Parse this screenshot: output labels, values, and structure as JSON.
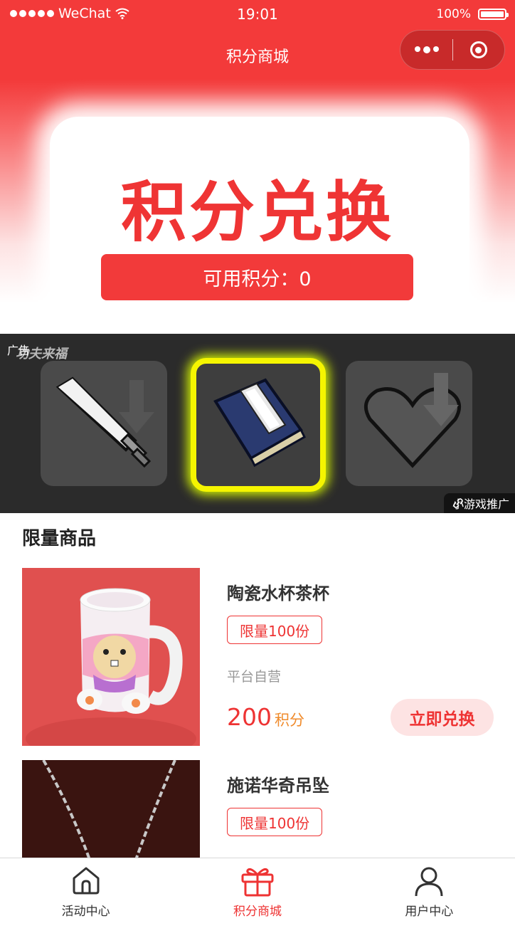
{
  "status_bar": {
    "carrier": "WeChat",
    "time": "19:01",
    "battery": "100%"
  },
  "nav": {
    "title": "积分商城"
  },
  "banner": {
    "title": "积分兑换",
    "points_label": "可用积分：0"
  },
  "ad": {
    "tag": "广告",
    "logo_text": "功夫来福",
    "promo": "小游戏推广",
    "tiles": [
      "sword-icon",
      "book-icon",
      "heart-icon"
    ]
  },
  "section": {
    "title": "限量商品"
  },
  "products": [
    {
      "name": "陶瓷水杯茶杯",
      "limit": "限量100份",
      "store": "平台自营",
      "price": "200",
      "unit": "积分",
      "button": "立即兑换"
    },
    {
      "name": "施诺华奇吊坠",
      "limit": "限量100份"
    }
  ],
  "tabbar": [
    {
      "label": "活动中心",
      "icon": "home-icon"
    },
    {
      "label": "积分商城",
      "icon": "gift-icon"
    },
    {
      "label": "用户中心",
      "icon": "user-icon"
    }
  ],
  "colors": {
    "primary": "#f33a3a",
    "accent": "#ee3333",
    "unit": "#f08a2a"
  }
}
